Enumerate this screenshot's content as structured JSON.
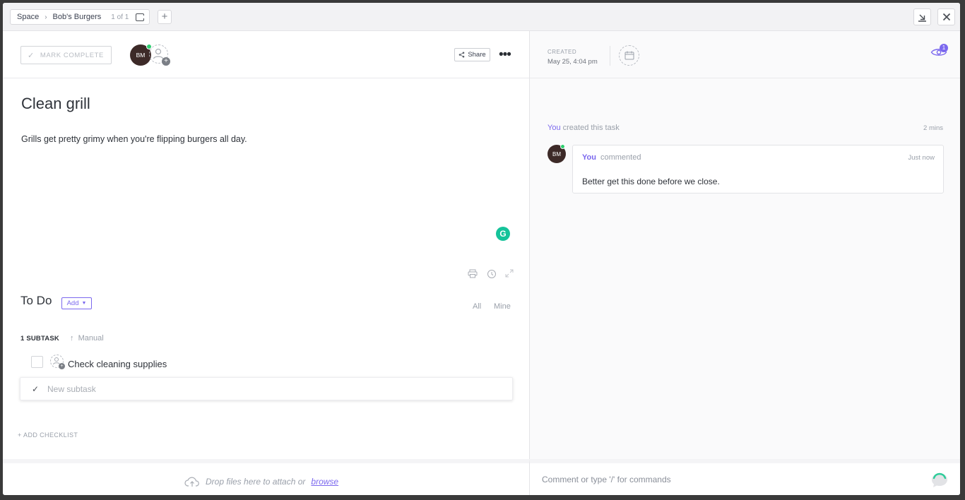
{
  "breadcrumb": {
    "space": "Space",
    "list": "Bob's Burgers",
    "count": "1 of 1"
  },
  "task": {
    "mark_complete": "MARK COMPLETE",
    "assignee_initials": "BM",
    "share_label": "Share",
    "title": "Clean grill",
    "description": "Grills get pretty grimy when you're flipping burgers all day.",
    "grammarly_letter": "G"
  },
  "todo": {
    "heading": "To Do",
    "add_label": "Add",
    "filter_all": "All",
    "filter_mine": "Mine",
    "subtask_count": "1 SUBTASK",
    "sort_label": "Manual",
    "subtasks": [
      {
        "name": "Check cleaning supplies"
      }
    ],
    "new_subtask_placeholder": "New subtask",
    "add_checklist": "+ ADD CHECKLIST"
  },
  "attach": {
    "text": "Drop files here to attach or",
    "link": "browse"
  },
  "activity": {
    "created_label": "CREATED",
    "created_value": "May 25, 4:04 pm",
    "watchers_count": "1",
    "event_actor": "You",
    "event_text": "created this task",
    "event_time": "2 mins",
    "comment": {
      "initials": "BM",
      "author": "You",
      "action": "commented",
      "time": "Just now",
      "body": "Better get this done before we close."
    },
    "comment_placeholder": "Comment or type '/' for commands"
  },
  "colors": {
    "accent": "#7b68ee",
    "avatar": "#3d2a28",
    "online": "#2ecd6f",
    "grammarly": "#15c39a"
  },
  "icons": [
    "chevron-right-icon",
    "open-task-icon",
    "plus-icon",
    "collapse-icon",
    "close-icon",
    "check-icon",
    "add-user-icon",
    "share-icon",
    "more-icon",
    "grammarly-icon",
    "print-icon",
    "history-icon",
    "expand-icon",
    "caret-down-icon",
    "sort-up-icon",
    "cloud-upload-icon",
    "calendar-icon",
    "eye-icon",
    "send-comment-icon"
  ]
}
